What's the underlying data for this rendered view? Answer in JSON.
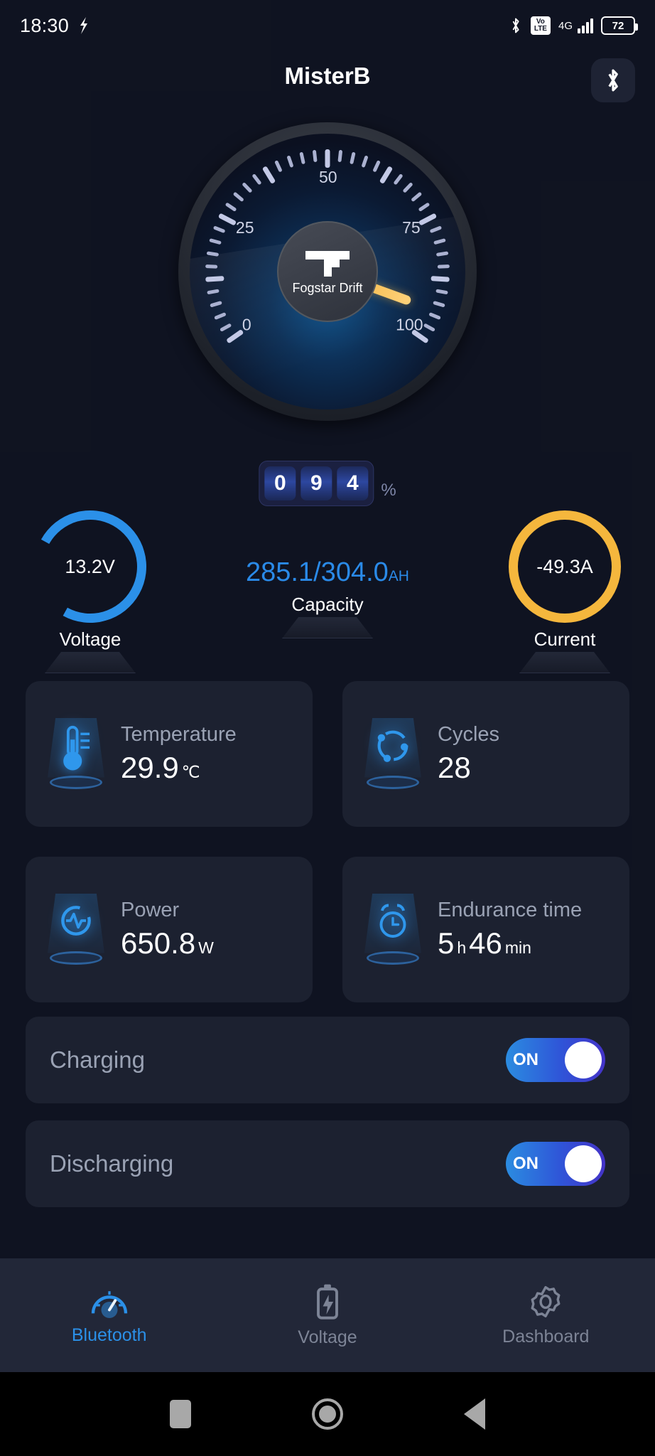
{
  "statusbar": {
    "time": "18:30",
    "location_icon": "location-icon",
    "bluetooth_icon": "bluetooth-icon",
    "volte_top": "Vo",
    "volte_bottom": "LTE",
    "network": "4G",
    "battery_percent": "72"
  },
  "header": {
    "title": "MisterB",
    "bluetooth_action_icon": "bluetooth-icon"
  },
  "gauge": {
    "brand": "Fogstar Drift",
    "tick_labels": [
      "0",
      "25",
      "50",
      "75",
      "100"
    ],
    "digits": [
      "0",
      "9",
      "4"
    ],
    "unit": "%",
    "value": 94,
    "min": 0,
    "max": 100,
    "needle_color": "#f0b03a"
  },
  "metrics": {
    "voltage": {
      "value": "13.2V",
      "label": "Voltage",
      "color": "#2b90e8"
    },
    "capacity": {
      "value": "285.1/304.0",
      "unit": "AH",
      "label": "Capacity",
      "color": "#2a8ae8"
    },
    "current": {
      "value": "-49.3A",
      "label": "Current",
      "color": "#f5b73d"
    }
  },
  "cards": [
    {
      "icon": "thermometer-icon",
      "title": "Temperature",
      "value": "29.9",
      "unit": "℃"
    },
    {
      "icon": "cycles-icon",
      "title": "Cycles",
      "value": "28",
      "unit": ""
    },
    {
      "icon": "power-icon",
      "title": "Power",
      "value": "650.8",
      "unit": "W"
    },
    {
      "icon": "clock-icon",
      "title": "Endurance time",
      "value": "5",
      "unit": "h",
      "value2": "46",
      "unit2": "min"
    }
  ],
  "toggles": [
    {
      "label": "Charging",
      "state": "ON"
    },
    {
      "label": "Discharging",
      "state": "ON"
    }
  ],
  "bottom_nav": [
    {
      "icon": "speedometer-icon",
      "label": "Bluetooth",
      "active": true
    },
    {
      "icon": "battery-icon",
      "label": "Voltage",
      "active": false
    },
    {
      "icon": "gear-icon",
      "label": "Dashboard",
      "active": false
    }
  ],
  "system_nav": {
    "recents": "square-icon",
    "home": "circle-icon",
    "back": "triangle-back-icon"
  }
}
